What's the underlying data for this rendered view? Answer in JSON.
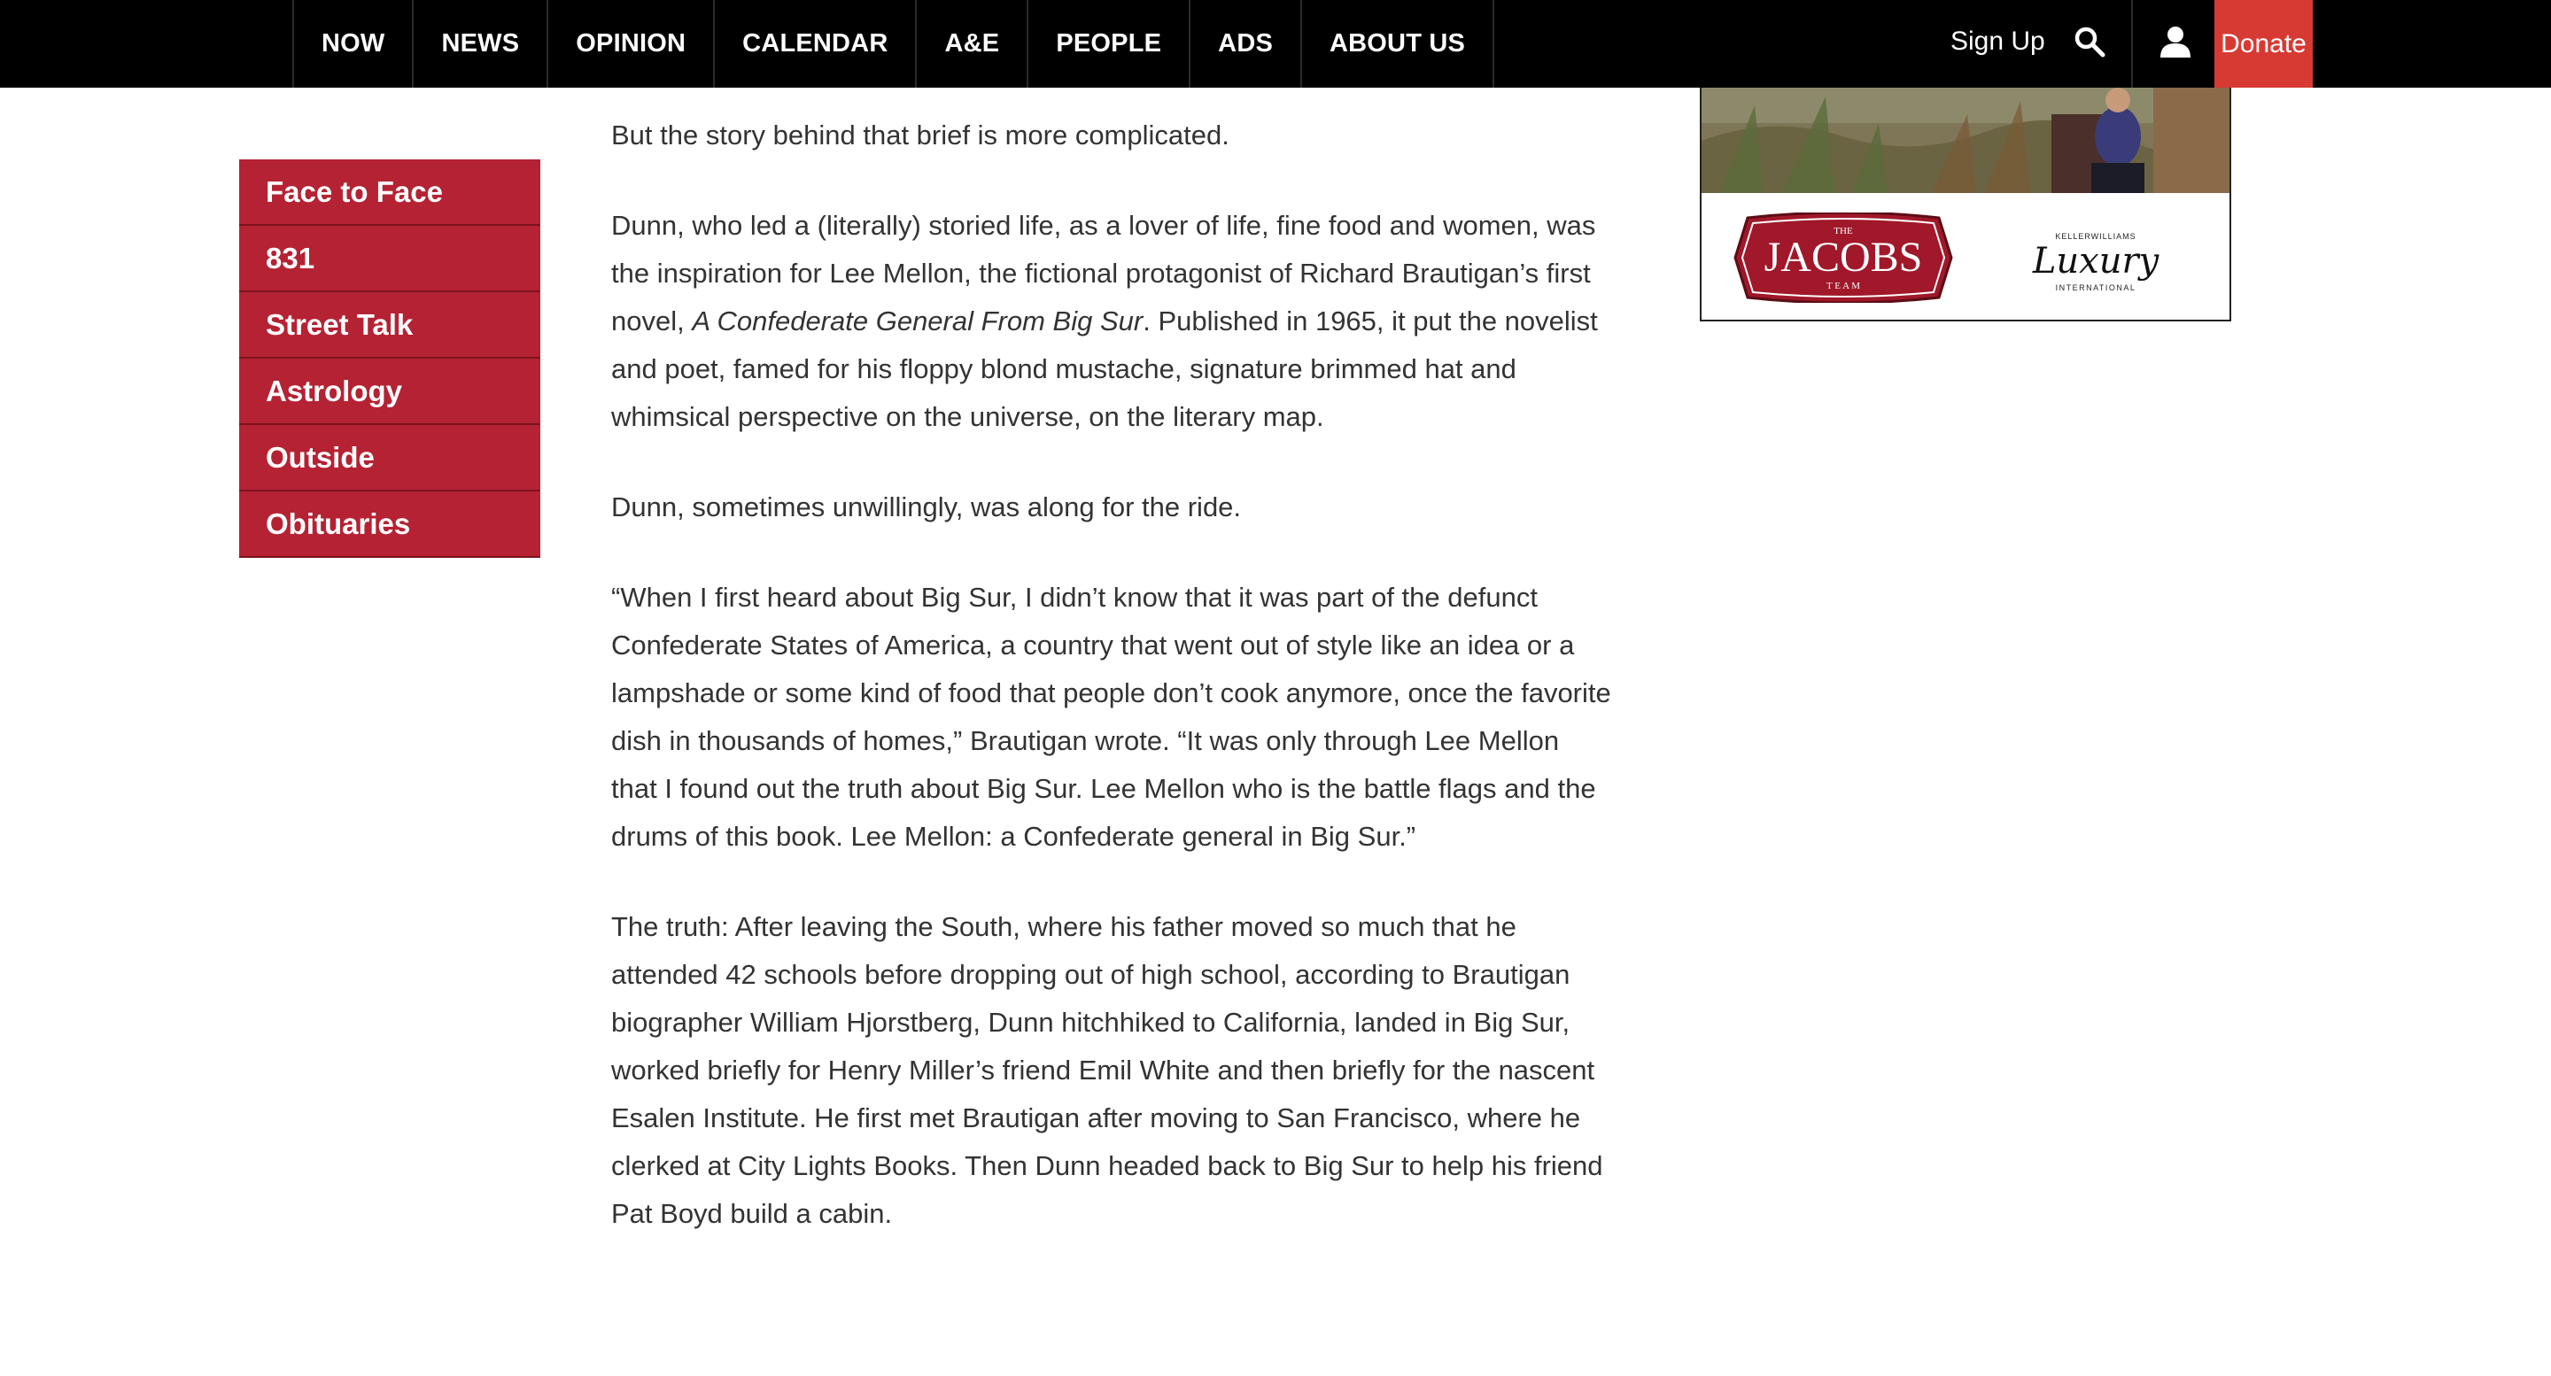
{
  "nav": {
    "items": [
      "NOW",
      "NEWS",
      "OPINION",
      "CALENDAR",
      "A&E",
      "PEOPLE",
      "ADS",
      "ABOUT US"
    ],
    "signup_label": "Sign Up",
    "donate_label": "Donate",
    "search_icon": "search-icon",
    "user_icon": "user-icon"
  },
  "sidebar": {
    "items": [
      "Face to Face",
      "831",
      "Street Talk",
      "Astrology",
      "Outside",
      "Obituaries"
    ]
  },
  "article": {
    "p1": "But the story behind that brief is more complicated.",
    "p2_before": "Dunn, who led a (literally) storied life, as a lover of life, fine food and women, was the inspiration for Lee Mellon, the fictional protagonist of Richard Brautigan’s first novel, ",
    "p2_title": "A Confederate General From Big Sur",
    "p2_after": ". Published in 1965, it put the novelist and poet, famed for his floppy blond mustache, signature brimmed hat and whimsical perspective on the universe, on the literary map.",
    "p3": "Dunn, sometimes unwillingly, was along for the ride.",
    "p4": "“When I first heard about Big Sur, I didn’t know that it was part of the defunct Confederate States of America, a country that went out of style like an idea or a lampshade or some kind of food that people don’t cook anymore, once the favorite dish in thousands of homes,” Brautigan wrote. “It was only through Lee Mellon that I found out the truth about Big Sur. Lee Mellon who is the battle flags and the drums of this book. Lee Mellon: a Confederate general in Big Sur.”",
    "p5": "The truth: After leaving the South, where his father moved so much that he attended 42 schools before dropping out of high school, according to Brautigan biographer William Hjorstberg, Dunn hitchhiked to California, landed in Big Sur, worked briefly for Henry Miller’s friend Emil White and then briefly for the nascent Esalen Institute. He first met Brautigan after moving to San Francisco, where he clerked at City Lights Books. Then Dunn headed back to Big Sur to help his friend Pat Boyd build a cabin."
  },
  "ad": {
    "jacobs_top": "THE",
    "jacobs_name": "JACOBS",
    "jacobs_bottom": "T E A M",
    "kw_label": "KELLERWILLIAMS",
    "luxury_label": "Luxury",
    "intl_label": "INTERNATIONAL"
  },
  "colors": {
    "topbar": "#000000",
    "donate": "#d73a32",
    "sidebar": "#b52233",
    "text": "#333333"
  }
}
